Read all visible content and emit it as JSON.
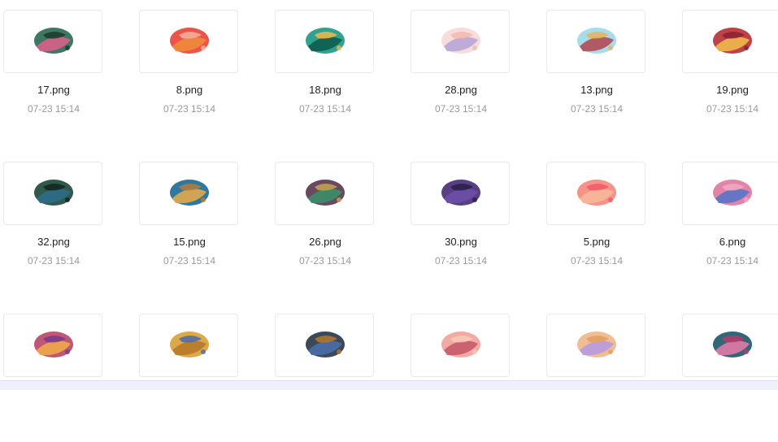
{
  "files": [
    {
      "name": "17.png",
      "time": "07-23 15:14",
      "icon": "paint-swatch-icon",
      "colors": [
        "#2e6b55",
        "#d85f8a",
        "#1b3a2c"
      ]
    },
    {
      "name": "8.png",
      "time": "07-23 15:14",
      "icon": "paint-swatch-icon",
      "colors": [
        "#e8453c",
        "#f08a3a",
        "#f5b3a0"
      ]
    },
    {
      "name": "18.png",
      "time": "07-23 15:14",
      "icon": "paint-swatch-icon",
      "colors": [
        "#1f9a86",
        "#0e5c50",
        "#f0b84a"
      ]
    },
    {
      "name": "28.png",
      "time": "07-23 15:14",
      "icon": "paint-swatch-icon",
      "colors": [
        "#f6d9d8",
        "#b7a5d6",
        "#f3b8b0"
      ]
    },
    {
      "name": "13.png",
      "time": "07-23 15:14",
      "icon": "paint-swatch-icon",
      "colors": [
        "#9fd9e8",
        "#b04b55",
        "#e6b35a"
      ]
    },
    {
      "name": "19.png",
      "time": "07-23 15:14",
      "icon": "paint-swatch-icon",
      "colors": [
        "#b8333a",
        "#f0b84a",
        "#8b2130"
      ]
    },
    {
      "name": "32.png",
      "time": "07-23 15:14",
      "icon": "paint-swatch-icon",
      "colors": [
        "#1f4a3c",
        "#2c6e8a",
        "#12261f"
      ]
    },
    {
      "name": "15.png",
      "time": "07-23 15:14",
      "icon": "paint-swatch-icon",
      "colors": [
        "#1f6c96",
        "#e2a84b",
        "#b57a3a"
      ]
    },
    {
      "name": "26.png",
      "time": "07-23 15:14",
      "icon": "paint-swatch-icon",
      "colors": [
        "#5b3a52",
        "#3a8f6a",
        "#c7a54b"
      ]
    },
    {
      "name": "30.png",
      "time": "07-23 15:14",
      "icon": "paint-swatch-icon",
      "colors": [
        "#4b2f7a",
        "#6b4fa8",
        "#2b1f4a"
      ]
    },
    {
      "name": "5.png",
      "time": "07-23 15:14",
      "icon": "paint-swatch-icon",
      "colors": [
        "#f58a7e",
        "#f8b89a",
        "#ee5a6a"
      ]
    },
    {
      "name": "6.png",
      "time": "07-23 15:14",
      "icon": "paint-swatch-icon",
      "colors": [
        "#e07aa0",
        "#5a73c9",
        "#f2a8c2"
      ]
    },
    {
      "name": "",
      "time": "",
      "icon": "paint-swatch-icon",
      "colors": [
        "#b84a6a",
        "#f0a84a",
        "#7a3a8a"
      ]
    },
    {
      "name": "",
      "time": "",
      "icon": "paint-swatch-icon",
      "colors": [
        "#d9a23a",
        "#b8782a",
        "#4a6aa8"
      ]
    },
    {
      "name": "",
      "time": "",
      "icon": "paint-swatch-icon",
      "colors": [
        "#2a3a4a",
        "#4a6ea8",
        "#b8782a"
      ]
    },
    {
      "name": "",
      "time": "",
      "icon": "paint-swatch-icon",
      "colors": [
        "#f0a49a",
        "#c85a6a",
        "#f6c9b8"
      ]
    },
    {
      "name": "",
      "time": "",
      "icon": "paint-swatch-icon",
      "colors": [
        "#f0b88a",
        "#b89ae0",
        "#e2a060"
      ]
    },
    {
      "name": "",
      "time": "",
      "icon": "paint-swatch-icon",
      "colors": [
        "#1f5a6e",
        "#e27aa8",
        "#b83a6a"
      ]
    }
  ]
}
